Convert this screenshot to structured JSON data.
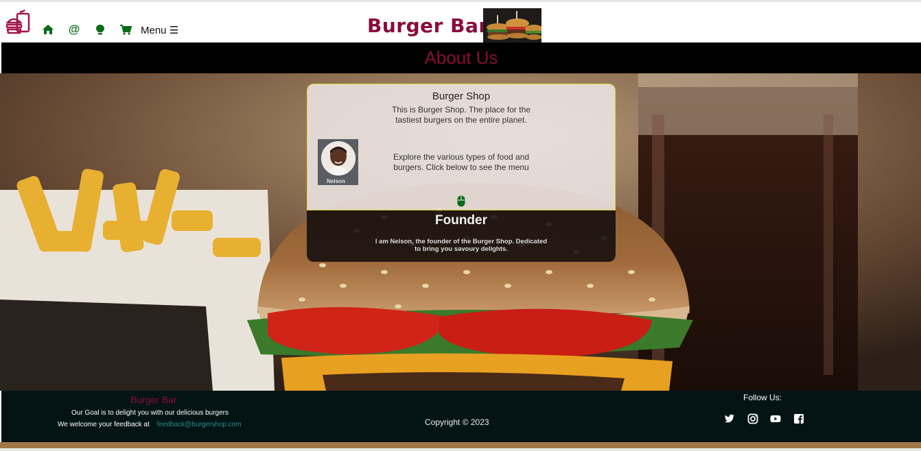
{
  "header": {
    "brand_name": "Burger Bar",
    "menu_label": "Menu ☰",
    "nav_icons": [
      "home-icon",
      "at-icon",
      "idea-icon",
      "cart-icon"
    ],
    "colors": {
      "brand": "#8a0c3a",
      "nav_green": "#0a6b18"
    }
  },
  "page": {
    "section_title": "About Us"
  },
  "card": {
    "title": "Burger Shop",
    "intro": "This is Burger Shop. The place for the tastiest burgers on the entire planet.",
    "explore": "Explore the various types of food and burgers. Click below to see the menu",
    "avatar_name": "Nelson",
    "founder_title": "Founder",
    "founder_text": "I am Nelson, the founder of the Burger Shop. Dedicated to bring you savoury delights."
  },
  "footer": {
    "brand": "Burger Bar",
    "goal": "Our Goal is to delight you with our delicious burgers",
    "feedback_label": "We welcome your feedback at",
    "feedback_email": "feedback@burgershop.com",
    "copyright": "Copyright © 2023",
    "follow_label": "Follow Us:",
    "social_icons": [
      "twitter-icon",
      "instagram-icon",
      "youtube-icon",
      "facebook-icon"
    ]
  }
}
